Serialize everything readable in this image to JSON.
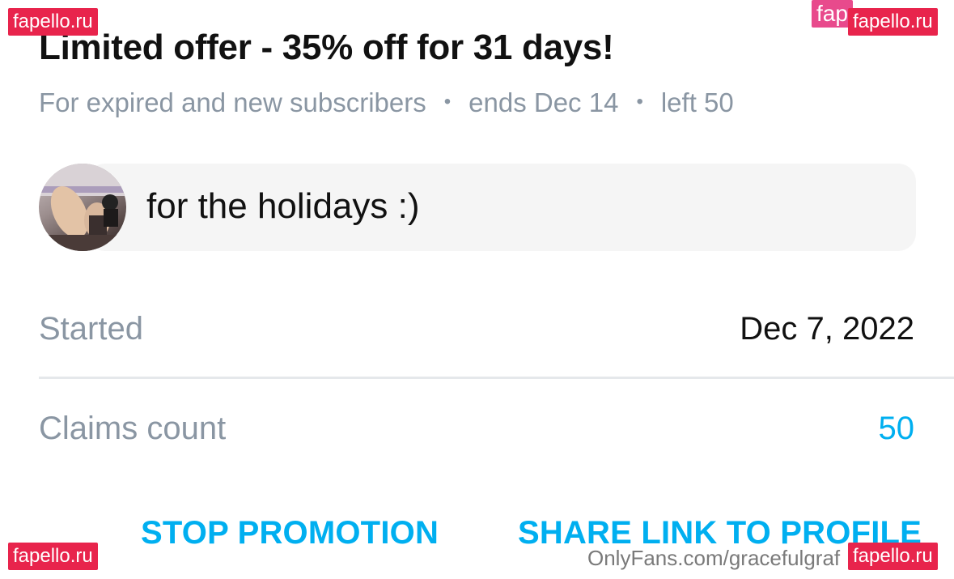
{
  "offer": {
    "title": "Limited offer - 35% off for 31 days!",
    "audience": "For expired and new subscribers",
    "separator": "•",
    "ends": "ends Dec 14",
    "left": "left 50"
  },
  "message": {
    "text": "for the holidays :)"
  },
  "details": {
    "started_label": "Started",
    "started_value": "Dec 7, 2022",
    "claims_label": "Claims count",
    "claims_value": "50"
  },
  "actions": {
    "stop_label": "STOP PROMOTION",
    "share_label": "SHARE LINK TO PROFILE"
  },
  "watermarks": {
    "site": "fapello.ru",
    "site_partial": "fap",
    "footer_url": "OnlyFans.com/gracefulgraf"
  },
  "colors": {
    "accent": "#00aff0",
    "muted": "#8a96a3",
    "watermark": "#e8244c"
  }
}
